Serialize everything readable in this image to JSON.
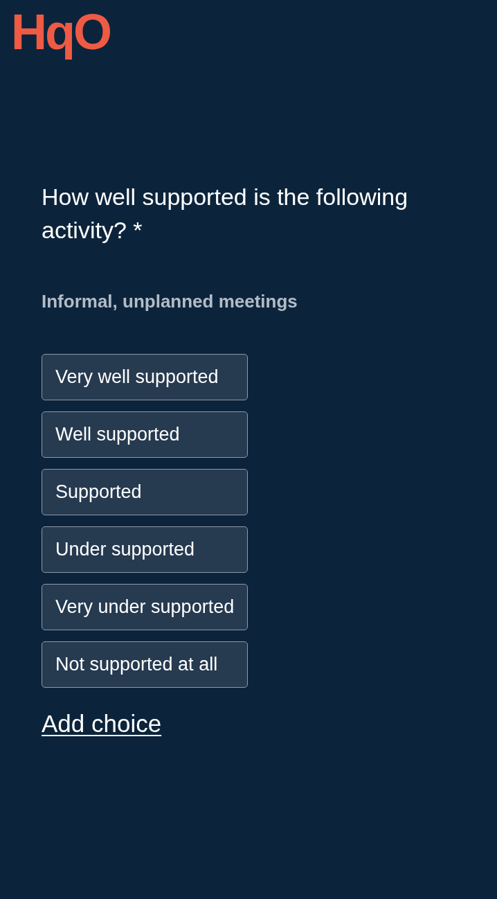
{
  "logo": {
    "text": "HqO"
  },
  "question": {
    "text": "How well supported is the following activity? *"
  },
  "activity": "Informal, unplanned meetings",
  "choices": [
    {
      "label": "Very well supported",
      "selected": false
    },
    {
      "label": "Well supported",
      "selected": false
    },
    {
      "label": "Supported",
      "selected": false
    },
    {
      "label": "Under supported",
      "selected": false
    },
    {
      "label": "Very under supported",
      "selected": false
    },
    {
      "label": "Not supported at all",
      "selected": false
    }
  ],
  "add_choice": {
    "label": "Add choice"
  }
}
